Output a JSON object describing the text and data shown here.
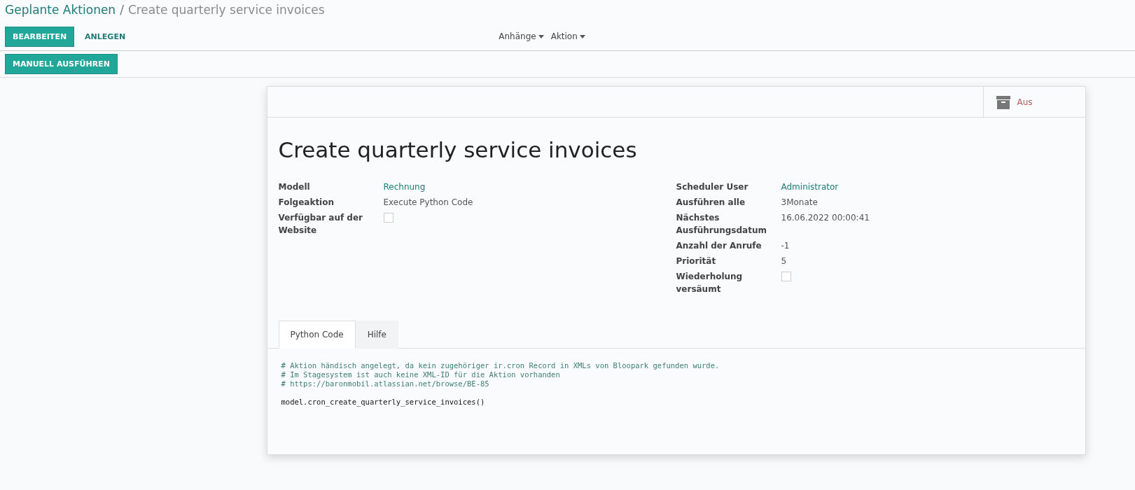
{
  "breadcrumb": {
    "parent": "Geplante Aktionen",
    "separator": "/",
    "current": "Create quarterly service invoices"
  },
  "buttons": [
    {
      "label": "BEARBEITEN",
      "kind": "primary"
    },
    {
      "label": "ANLEGEN",
      "kind": "link"
    }
  ],
  "dropdowns": [
    "Anhänge",
    "Aktion"
  ],
  "header_buttons": [
    "MANUELL AUSFÜHREN"
  ],
  "archive_toggle": {
    "label": "Aus",
    "on": false
  },
  "record_title": "Create quarterly service invoices",
  "left_fields": [
    {
      "label": "Modell",
      "kind": "link",
      "value": "Rechnung"
    },
    {
      "label": "Folgeaktion",
      "kind": "text",
      "value": "Execute Python Code"
    },
    {
      "label": "Verfügbar auf der Website",
      "kind": "checkbox",
      "checked": false
    }
  ],
  "right_fields": [
    {
      "label": "Scheduler User",
      "kind": "link",
      "value": "Administrator"
    },
    {
      "label": "Ausführen alle",
      "kind": "text",
      "value": "3Monate"
    },
    {
      "label": "Nächstes Ausführungsdatum",
      "kind": "text",
      "value": "16.06.2022 00:00:41"
    },
    {
      "label": "Anzahl der Anrufe",
      "kind": "text",
      "value": "-1"
    },
    {
      "label": "Priorität",
      "kind": "text",
      "value": "5"
    },
    {
      "label": "Wiederholung versäumt",
      "kind": "checkbox",
      "checked": false
    }
  ],
  "tabs": [
    {
      "label": "Python Code",
      "selected": true
    },
    {
      "label": "Hilfe",
      "selected": false
    }
  ],
  "code_lines": [
    {
      "kind": "comment",
      "text": "# Aktion händisch angelegt, da kein zugehöriger ir.cron Record in XMLs von Bloopark gefunden wurde."
    },
    {
      "kind": "comment",
      "text": "# Im Stagesystem ist auch keine XML-ID für die Aktion vorhanden"
    },
    {
      "kind": "comment",
      "text": "# https://baronmobil.atlassian.net/browse/BE-85"
    },
    {
      "kind": "code",
      "text": "model.cron_create_quarterly_service_invoices()"
    }
  ]
}
